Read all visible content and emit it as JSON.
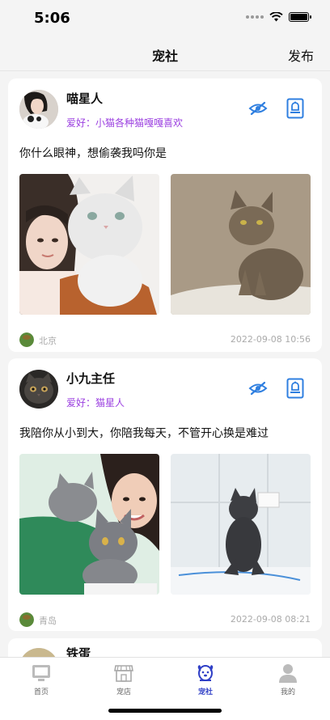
{
  "status_bar": {
    "time": "5:06"
  },
  "nav": {
    "title": "宠社",
    "publish": "发布"
  },
  "posts": [
    {
      "username": "喵星人",
      "hobby": "爱好：小猫各种猫嘎嘎喜欢",
      "text": "你什么眼神，想偷袭我吗你是",
      "location": "北京",
      "date": "2022-09-08 10:56"
    },
    {
      "username": "小九主任",
      "hobby": "爱好：猫星人",
      "text": "我陪你从小到大，你陪我每天，不管开心换是难过",
      "location": "青岛",
      "date": "2022-09-08 08:21"
    },
    {
      "username": "铁蛋"
    }
  ],
  "tabs": [
    {
      "label": "首页"
    },
    {
      "label": "宠店"
    },
    {
      "label": "宠社"
    },
    {
      "label": "我的"
    }
  ],
  "colors": {
    "accent": "#2f3fc6",
    "hobby": "#9b3fe0",
    "icon_blue": "#2f7fe0"
  }
}
